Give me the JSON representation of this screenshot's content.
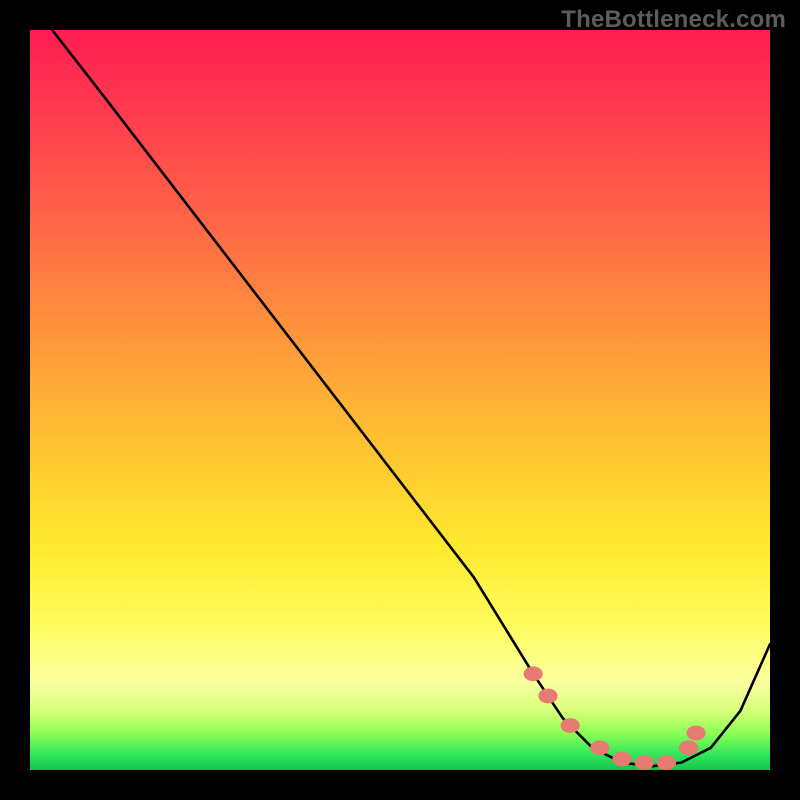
{
  "watermark": "TheBottleneck.com",
  "chart_data": {
    "type": "line",
    "title": "",
    "xlabel": "",
    "ylabel": "",
    "xlim": [
      0,
      100
    ],
    "ylim": [
      0,
      100
    ],
    "series": [
      {
        "name": "curve",
        "x": [
          3,
          10,
          20,
          30,
          40,
          50,
          60,
          68,
          72,
          76,
          80,
          84,
          88,
          92,
          96,
          100
        ],
        "values": [
          100,
          91,
          78,
          65,
          52,
          39,
          26,
          13,
          7,
          3,
          1,
          0.5,
          1,
          3,
          8,
          17
        ]
      }
    ],
    "markers": {
      "name": "dots",
      "x": [
        68,
        70,
        73,
        77,
        80,
        83,
        86,
        89,
        90
      ],
      "values": [
        13,
        10,
        6,
        3,
        1.5,
        1,
        1,
        3,
        5
      ]
    },
    "gradient_stops": [
      {
        "pos": 0,
        "color": "#ff1d52"
      },
      {
        "pos": 10,
        "color": "#ff3850"
      },
      {
        "pos": 28,
        "color": "#ff6c46"
      },
      {
        "pos": 43,
        "color": "#ff9b3a"
      },
      {
        "pos": 57,
        "color": "#ffc531"
      },
      {
        "pos": 70,
        "color": "#ffe92f"
      },
      {
        "pos": 80,
        "color": "#fffb5a"
      },
      {
        "pos": 88,
        "color": "#fbffa0"
      },
      {
        "pos": 92,
        "color": "#d6ff7a"
      },
      {
        "pos": 95,
        "color": "#8dff56"
      },
      {
        "pos": 98,
        "color": "#2fe65a"
      },
      {
        "pos": 100,
        "color": "#16c44e"
      }
    ],
    "colors": {
      "curve": "#000000",
      "marker": "#e77b72",
      "background_border": "#000000"
    }
  }
}
